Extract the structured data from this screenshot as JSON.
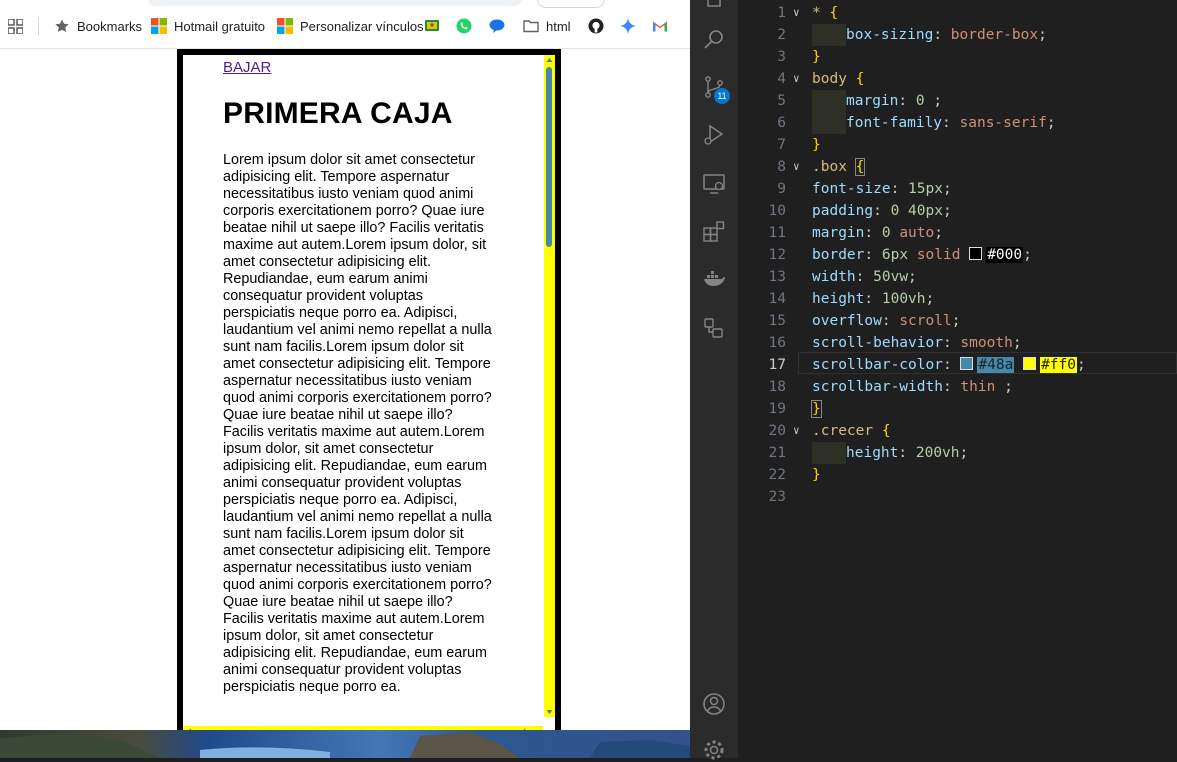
{
  "bookmarks_bar": {
    "items": [
      {
        "label": "Bookmarks",
        "icon": "star-icon"
      },
      {
        "label": "Hotmail gratuito",
        "icon": "microsoft-logo-icon"
      },
      {
        "label": "Personalizar vínculos",
        "icon": "microsoft-logo-icon"
      },
      {
        "label": "",
        "icon": "google-classroom-icon"
      },
      {
        "label": "",
        "icon": "whatsapp-icon"
      },
      {
        "label": "",
        "icon": "chat-bubble-icon"
      },
      {
        "label": "html",
        "icon": "folder-icon"
      },
      {
        "label": "",
        "icon": "github-icon"
      },
      {
        "label": "",
        "icon": "sparkle-icon"
      },
      {
        "label": "",
        "icon": "gmail-icon"
      }
    ]
  },
  "page": {
    "link_label": "BAJAR",
    "heading": "PRIMERA CAJA",
    "paragraph": "Lorem ipsum dolor sit amet consectetur adipisicing elit. Tempore aspernatur necessitatibus iusto veniam quod animi corporis exercitationem porro? Quae iure beatae nihil ut saepe illo? Facilis veritatis maxime aut autem.Lorem ipsum dolor, sit amet consectetur adipisicing elit. Repudiandae, eum earum animi consequatur provident voluptas perspiciatis neque porro ea. Adipisci, laudantium vel animi nemo repellat a nulla sunt nam facilis.Lorem ipsum dolor sit amet consectetur adipisicing elit. Tempore aspernatur necessitatibus iusto veniam quod animi corporis exercitationem porro? Quae iure beatae nihil ut saepe illo? Facilis veritatis maxime aut autem.Lorem ipsum dolor, sit amet consectetur adipisicing elit. Repudiandae, eum earum animi consequatur provident voluptas perspiciatis neque porro ea. Adipisci, laudantium vel animi nemo repellat a nulla sunt nam facilis.Lorem ipsum dolor sit amet consectetur adipisicing elit. Tempore aspernatur necessitatibus iusto veniam quod animi corporis exercitationem porro? Quae iure beatae nihil ut saepe illo? Facilis veritatis maxime aut autem.Lorem ipsum dolor, sit amet consectetur adipisicing elit. Repudiandae, eum earum animi consequatur provident voluptas perspiciatis neque porro ea.",
    "scrollbar_thumb_color": "#48a",
    "scrollbar_track_color": "#ff0"
  },
  "activity_bar": {
    "icons": [
      "files-icon",
      "search-icon",
      "source-control-icon",
      "run-debug-icon",
      "remote-explorer-icon",
      "extensions-icon",
      "docker-icon",
      "remote-icon",
      "account-icon",
      "settings-gear-icon"
    ],
    "source_control_badge": "11"
  },
  "editor": {
    "current_line": 17,
    "lines": [
      {
        "n": "1",
        "fold": true,
        "html": "<span class='sel'>*</span> <span class='brace'>{</span>"
      },
      {
        "n": "2",
        "ind": 1,
        "html": "<span class='prop'>box-sizing</span><span class='punct'>: </span><span class='val'>border-box</span><span class='punct'>;</span>"
      },
      {
        "n": "3",
        "html": "<span class='brace'>}</span>"
      },
      {
        "n": "4",
        "fold": true,
        "html": "<span class='sel'>body</span> <span class='brace'>{</span>"
      },
      {
        "n": "5",
        "ind": 1,
        "html": "<span class='prop'>margin</span><span class='punct'>: </span><span class='num'>0</span><span class='punct'> ;</span>"
      },
      {
        "n": "6",
        "ind": 1,
        "html": "<span class='prop'>font-family</span><span class='punct'>: </span><span class='val'>sans-serif</span><span class='punct'>;</span>"
      },
      {
        "n": "7",
        "html": "<span class='brace'>}</span>"
      },
      {
        "n": "8",
        "fold": true,
        "html": "<span class='sel'>.box</span> <span class='brace' style='outline:1px solid #888'>{</span>"
      },
      {
        "n": "9",
        "html": "<span class='prop'>font-size</span><span class='punct'>: </span><span class='num'>15px</span><span class='punct'>;</span>"
      },
      {
        "n": "10",
        "html": "<span class='prop'>padding</span><span class='punct'>: </span><span class='num'>0 40px</span><span class='punct'>;</span>"
      },
      {
        "n": "11",
        "html": "<span class='prop'>margin</span><span class='punct'>: </span><span class='num'>0</span> <span class='val'>auto</span><span class='punct'>;</span>"
      },
      {
        "n": "12",
        "html": "<span class='prop'>border</span><span class='punct'>: </span><span class='num'>6px</span> <span class='val'>solid</span> <span class='swatch' style='background:#000'></span><span class='hl000'>#000</span><span class='punct'>;</span>"
      },
      {
        "n": "13",
        "html": "<span class='prop'>width</span><span class='punct'>: </span><span class='num'>50vw</span><span class='punct'>;</span>"
      },
      {
        "n": "14",
        "html": "<span class='prop'>height</span><span class='punct'>: </span><span class='num'>100vh</span><span class='punct'>;</span>"
      },
      {
        "n": "15",
        "html": "<span class='prop'>overflow</span><span class='punct'>: </span><span class='val'>scroll</span><span class='punct'>;</span>"
      },
      {
        "n": "16",
        "html": "<span class='prop'>scroll-behavior</span><span class='punct'>: </span><span class='val'>smooth</span><span class='punct'>;</span>"
      },
      {
        "n": "17",
        "html": "<span class='prop'>scrollbar-color</span><span class='punct'>: </span><span class='swatch' style='background:#48a'></span><span class='hl48a'>#48a</span> <span class='swatch' style='background:#ff0'></span><span class='hlff0'>#ff0</span><span class='punct'>;</span>"
      },
      {
        "n": "18",
        "html": "<span class='prop'>scrollbar-width</span><span class='punct'>: </span><span class='val'>thin</span><span class='punct'> ;</span>"
      },
      {
        "n": "19",
        "html": "<span class='brace' style='outline:1px solid #888'>}</span>"
      },
      {
        "n": "20",
        "fold": true,
        "html": "<span class='sel'>.crecer</span> <span class='brace'>{</span>"
      },
      {
        "n": "21",
        "ind": 1,
        "html": "<span class='prop'>height</span><span class='punct'>: </span><span class='num'>200vh</span><span class='punct'>;</span>"
      },
      {
        "n": "22",
        "html": "<span class='brace'>}</span>"
      },
      {
        "n": "23",
        "html": ""
      }
    ]
  }
}
